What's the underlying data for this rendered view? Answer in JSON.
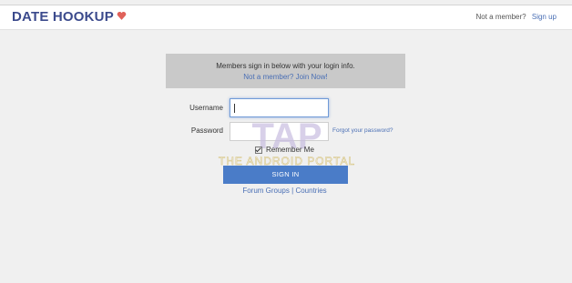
{
  "header": {
    "logo_text": "DATE HOOKUP",
    "not_member_text": "Not a member?",
    "signup_link": "Sign up"
  },
  "notice": {
    "message": "Members sign in below with your login info.",
    "join_link": "Not a member? Join Now!"
  },
  "form": {
    "username_label": "Username",
    "username_value": "",
    "password_label": "Password",
    "password_value": "",
    "forgot_link": "Forgot your password?",
    "remember_label": "Remember Me",
    "remember_checked": true,
    "signin_button": "SIGN IN"
  },
  "footer_links": {
    "forum_groups": "Forum Groups",
    "separator": "|",
    "countries": "Countries"
  },
  "watermark": {
    "logo_text": "TAP",
    "caption": "THE ANDROID PORTAL"
  },
  "colors": {
    "brand": "#3b4a8c",
    "heart": "#e0625a",
    "link": "#4a6fb5",
    "button": "#4a7cc8"
  }
}
